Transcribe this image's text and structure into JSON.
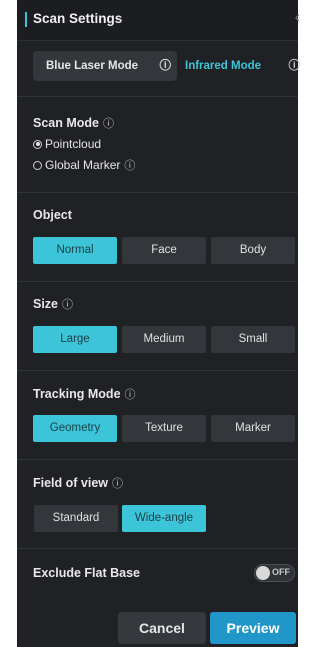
{
  "header": {
    "title": "Scan Settings",
    "collapse_icon": "chevron-left-icon"
  },
  "laser": {
    "blue_label": "Blue Laser Mode",
    "ir_label": "Infrared Mode",
    "info_icon": "ⓘ"
  },
  "scan_mode": {
    "title": "Scan Mode",
    "options": [
      {
        "label": "Pointcloud",
        "selected": true
      },
      {
        "label": "Global Marker",
        "selected": false
      }
    ]
  },
  "object": {
    "title": "Object",
    "options": [
      "Normal",
      "Face",
      "Body"
    ],
    "selected": "Normal"
  },
  "size": {
    "title": "Size",
    "options": [
      "Large",
      "Medium",
      "Small"
    ],
    "selected": "Large"
  },
  "tracking": {
    "title": "Tracking Mode",
    "options": [
      "Geometry",
      "Texture",
      "Marker"
    ],
    "selected": "Geometry"
  },
  "fov": {
    "title": "Field of view",
    "options": [
      "Standard",
      "Wide-angle"
    ],
    "selected": "Wide-angle"
  },
  "exclude_flat_base": {
    "title": "Exclude Flat Base",
    "toggle": "OFF"
  },
  "footer": {
    "cancel": "Cancel",
    "preview": "Preview"
  },
  "colors": {
    "accent": "#3cc4d8",
    "preview": "#2096c9",
    "panel": "#1f2124"
  }
}
